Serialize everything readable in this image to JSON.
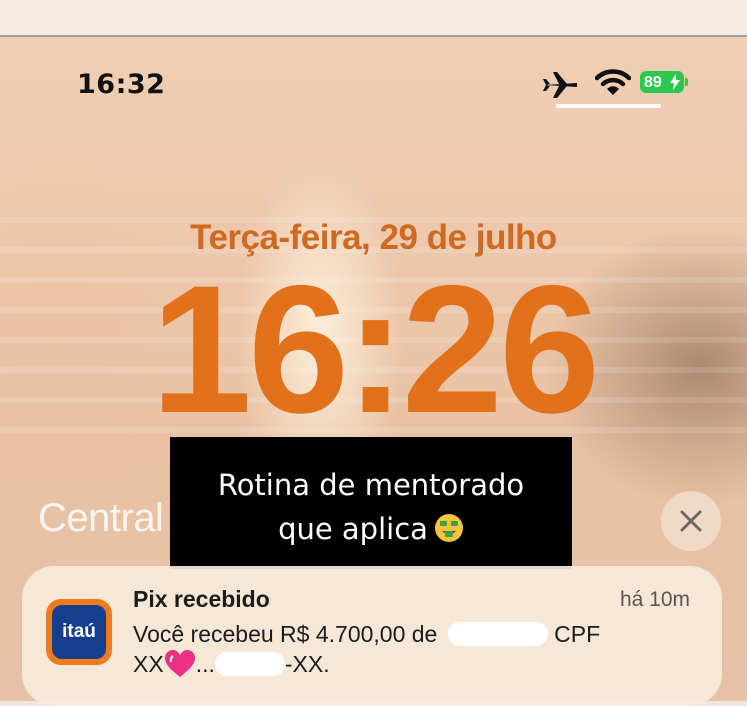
{
  "status_bar": {
    "time": "16:32",
    "battery_percent": "89",
    "airplane_mode": true,
    "wifi": true
  },
  "lock_screen": {
    "date": "Terça-feira, 29 de julho",
    "time": "16:26",
    "notification_center_label": "Central"
  },
  "caption": {
    "line1": "Rotina de mentorado",
    "line2": "que aplica"
  },
  "notification": {
    "app_icon_label": "itaú",
    "title": "Pix recebido",
    "time_ago": "há 10m",
    "body_start": "Você recebeu R$ 4.700,00 de",
    "body_cpf": "CPF",
    "body_line2_start": "XX",
    "body_line2_mid": "...",
    "body_line2_end": "-XX."
  },
  "colors": {
    "clock_orange": "#e2711c",
    "date_orange": "#cf6a24",
    "battery_green": "#2fc84f",
    "itau_orange": "#ef7b1f",
    "itau_blue": "#153e8f"
  },
  "icons": [
    "airplane-icon",
    "wifi-icon",
    "battery-icon",
    "close-icon",
    "money-mouth-face-emoji",
    "heart-sticker"
  ]
}
